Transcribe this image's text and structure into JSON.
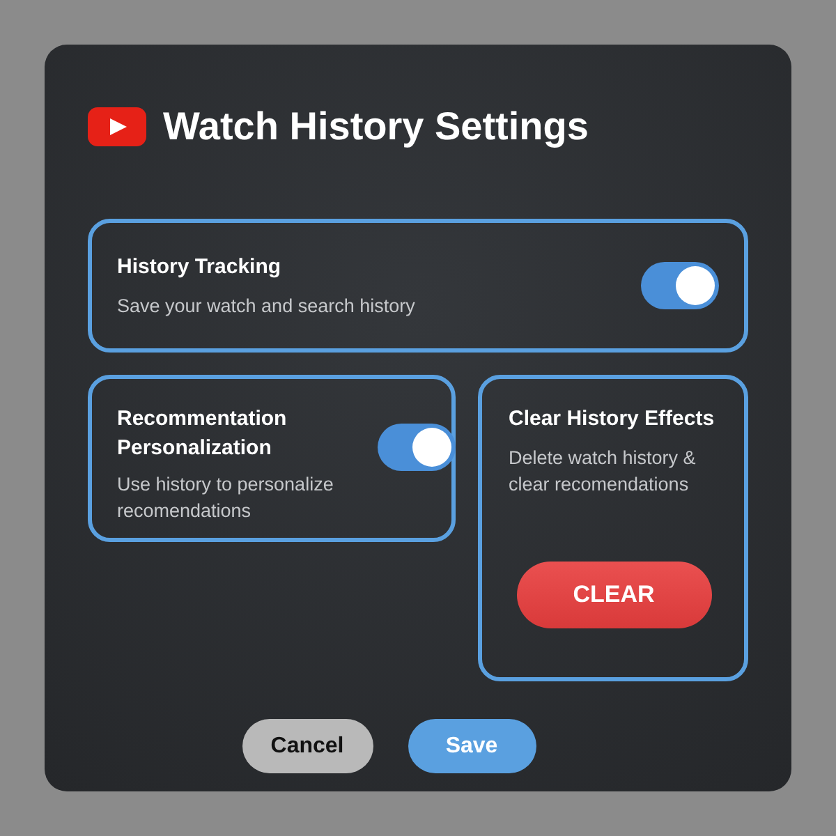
{
  "dialog": {
    "title": "Watch History Settings"
  },
  "settings": [
    {
      "title": "History Tracking",
      "description": "Save your watch and search history",
      "on": true
    },
    {
      "title": "Recommentation Personalization",
      "description": "Use history to personalize recomendations",
      "on": true
    }
  ],
  "clear_card": {
    "title": "Clear History Effects",
    "description": "Delete watch history & clear recomendations",
    "button": "CLEAR"
  },
  "buttons": [
    {
      "label": "Cancel",
      "kind": "secondary"
    },
    {
      "label": "Save",
      "kind": "primary"
    }
  ]
}
